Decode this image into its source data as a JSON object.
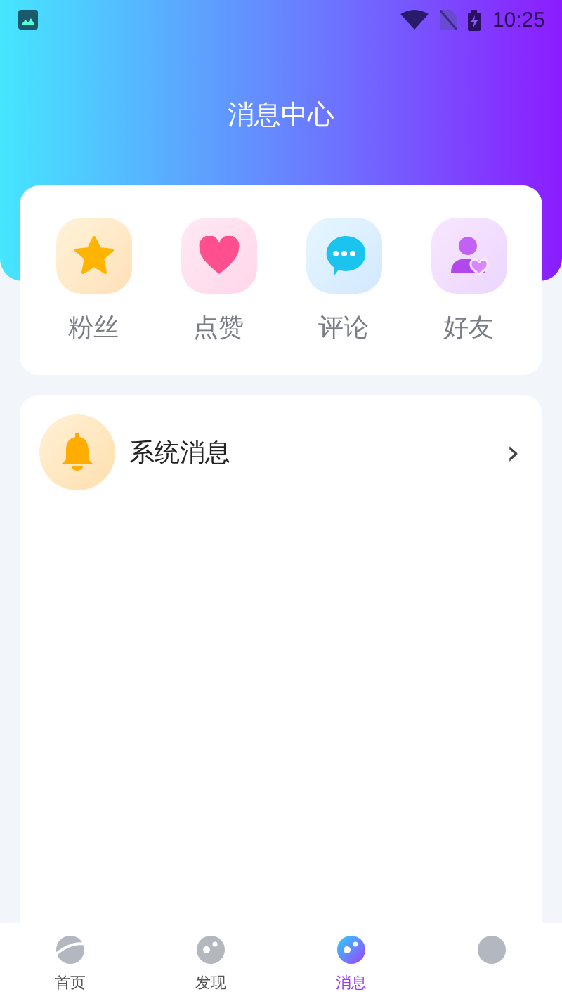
{
  "status_bar": {
    "time": "10:25"
  },
  "header": {
    "title": "消息中心"
  },
  "categories": [
    {
      "label": "粉丝"
    },
    {
      "label": "点赞"
    },
    {
      "label": "评论"
    },
    {
      "label": "好友"
    }
  ],
  "messages": [
    {
      "title": "系统消息",
      "chevron": "›"
    }
  ],
  "bottom_nav": [
    {
      "label": "首页",
      "selected": false
    },
    {
      "label": "发现",
      "selected": false
    },
    {
      "label": "消息",
      "selected": true
    },
    {
      "selected": false
    }
  ]
}
